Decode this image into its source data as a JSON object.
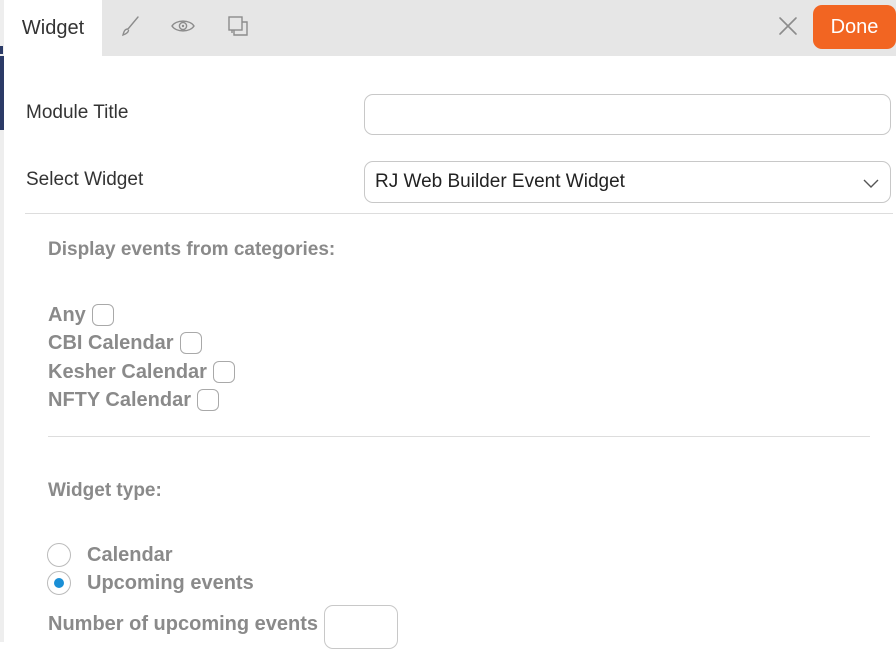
{
  "toolbar": {
    "active_tab": "Widget",
    "tools": [
      {
        "icon": "brush-icon"
      },
      {
        "icon": "eye-icon"
      },
      {
        "icon": "copy-icon"
      }
    ],
    "close_icon": "close-icon",
    "done_label": "Done"
  },
  "form": {
    "module_title_label": "Module Title",
    "module_title_value": "",
    "select_widget_label": "Select Widget",
    "select_widget_value": "RJ Web Builder Event Widget"
  },
  "categories": {
    "heading": "Display events from categories:",
    "items": [
      {
        "label": "Any",
        "checked": false
      },
      {
        "label": "CBI Calendar",
        "checked": false
      },
      {
        "label": "Kesher Calendar",
        "checked": false
      },
      {
        "label": "NFTY Calendar",
        "checked": false
      }
    ]
  },
  "widget_type": {
    "heading": "Widget type:",
    "options": [
      {
        "label": "Calendar",
        "checked": false
      },
      {
        "label": "Upcoming events",
        "checked": true
      }
    ]
  },
  "upcoming": {
    "label": "Number of upcoming events",
    "value": ""
  },
  "colors": {
    "accent": "#f26522",
    "radio_selected": "#1a8fd6",
    "topbar": "#e6e6e6",
    "muted_text": "#8a8a8a"
  }
}
